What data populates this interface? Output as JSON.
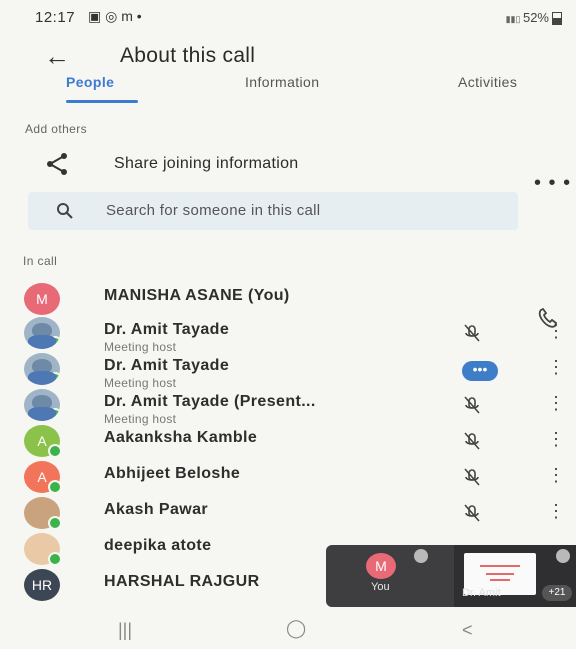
{
  "status_bar": {
    "time": "12:17",
    "icons_left": "▣ ◎ m •",
    "network": "Vo0 4G+ LTE1 LTE",
    "battery_text": "52%"
  },
  "header": {
    "title": "About this call"
  },
  "tabs": [
    {
      "label": "People"
    },
    {
      "label": "Information"
    },
    {
      "label": "Activities"
    }
  ],
  "add_others": {
    "label": "Add others",
    "share_label": "Share joining information",
    "search_placeholder": "Search for someone in this call"
  },
  "in_call_label": "In call",
  "participants": [
    {
      "name": "MANISHA ASANE (You)",
      "subtitle": "",
      "initial": "M",
      "avatar_color": "#e86a77",
      "avatar_type": "initial"
    },
    {
      "name": "Dr. Amit Tayade",
      "subtitle": "Meeting host",
      "initial": "",
      "avatar_color": "#9fb4c7",
      "avatar_type": "photo",
      "status": "mic-off"
    },
    {
      "name": "Dr. Amit Tayade",
      "subtitle": "Meeting host",
      "initial": "",
      "avatar_color": "#9fb4c7",
      "avatar_type": "photo",
      "status": "speaking"
    },
    {
      "name": "Dr. Amit Tayade (Present...",
      "subtitle": "Meeting host",
      "initial": "",
      "avatar_color": "#9fb4c7",
      "avatar_type": "photo",
      "status": "mic-off"
    },
    {
      "name": "Aakanksha Kamble",
      "subtitle": "",
      "initial": "A",
      "avatar_color": "#8bc34a",
      "avatar_type": "initial",
      "status": "mic-off"
    },
    {
      "name": "Abhijeet Beloshe",
      "subtitle": "",
      "initial": "A",
      "avatar_color": "#f2745a",
      "avatar_type": "initial",
      "status": "mic-off"
    },
    {
      "name": "Akash Pawar",
      "subtitle": "",
      "initial": "",
      "avatar_color": "#c9a27e",
      "avatar_type": "photo",
      "status": "mic-off"
    },
    {
      "name": "deepika atote",
      "subtitle": "",
      "initial": "",
      "avatar_color": "#e9c9a6",
      "avatar_type": "photo"
    },
    {
      "name": "HARSHAL RAJGUR",
      "subtitle": "",
      "initial": "HR",
      "avatar_color": "#3c4654",
      "avatar_type": "initial"
    }
  ],
  "pip": {
    "self_initial": "M",
    "self_label": "You",
    "other_name": "Dr. Amit",
    "extra_count": "+21"
  },
  "colors": {
    "accent": "#3d7bd3",
    "online_dot": "#3cb34a",
    "search_bg": "#e7eef2"
  }
}
